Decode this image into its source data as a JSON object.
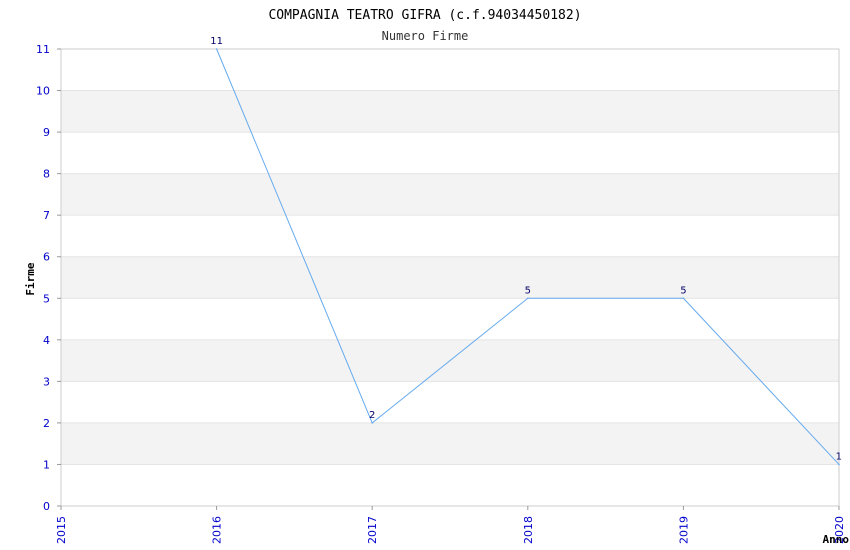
{
  "chart_data": {
    "type": "line",
    "title": "COMPAGNIA TEATRO GIFRA (c.f.94034450182)",
    "subtitle": "Numero Firme",
    "xlabel": "Anno",
    "ylabel": "Firme",
    "xlim": [
      2015,
      2020
    ],
    "ylim": [
      0,
      11
    ],
    "x_ticks": [
      "2015",
      "2016",
      "2017",
      "2018",
      "2019",
      "2020"
    ],
    "y_ticks": [
      "0",
      "1",
      "2",
      "3",
      "4",
      "5",
      "6",
      "7",
      "8",
      "9",
      "10",
      "11"
    ],
    "grid": "horizontal bands",
    "series": [
      {
        "x": [
          2016,
          2017,
          2018,
          2019,
          2020
        ],
        "values": [
          11,
          2,
          5,
          5,
          1
        ],
        "labels": [
          "11",
          "2",
          "5",
          "5",
          "1"
        ],
        "color": "#66aaee"
      }
    ],
    "band_color": "#f3f3f3",
    "tick_color": "#0000cc"
  }
}
